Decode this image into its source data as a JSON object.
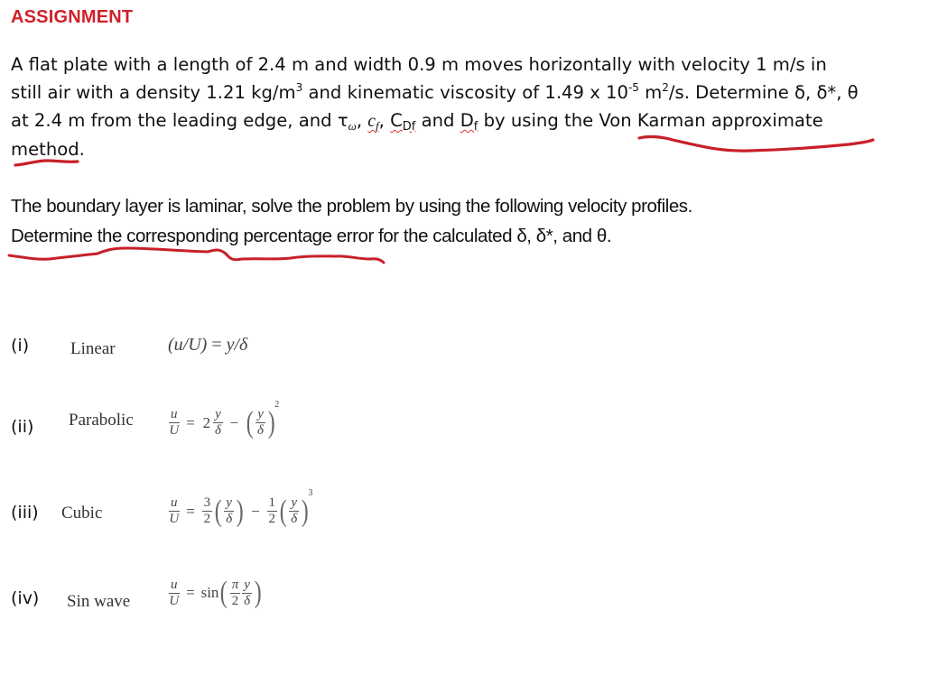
{
  "title": "ASSIGNMENT",
  "problem": {
    "line1": "A flat plate with a length of 2.4 m and width 0.9 m moves horizontally with velocity 1 m/s in",
    "line2_a": "still air with a density 1.21 kg/m",
    "line2_sup1": "3",
    "line2_b": " and kinematic viscosity of 1.49 x 10",
    "line2_sup2": "-5",
    "line2_c": " m",
    "line2_sup3": "2",
    "line2_d": "/s. Determine δ, δ*, θ",
    "line3_a": "at 2.4 m from the leading edge, and ",
    "tau": "τ",
    "tau_sub": "ω",
    "sep1": ", ",
    "cf": "c",
    "cf_sub": "f",
    "sep2": ", ",
    "cdf": "C",
    "cdf_sub": "Df",
    "line3_b": " and ",
    "df": "D",
    "df_sub": "f",
    "line3_c": " by using the Von Karman approximate",
    "line4": "method."
  },
  "instructions": {
    "line1": "The boundary layer is laminar, solve the problem by using the following velocity profiles.",
    "line2": "Determine the corresponding percentage error for the calculated δ, δ*, and θ."
  },
  "profiles": [
    {
      "label": "(i)",
      "name": "Linear",
      "equation": "(u/U) = y/δ"
    },
    {
      "label": "(ii)",
      "name": "Parabolic",
      "equation": "u/U = 2 y/δ − (y/δ)²"
    },
    {
      "label": "(iii)",
      "name": "Cubic",
      "equation": "u/U = 3/2 (y/δ) − 1/2 (y/δ)³"
    },
    {
      "label": "(iv)",
      "name": "Sin wave",
      "equation": "u/U = sin(π/2 · y/δ)"
    }
  ],
  "eq_parts": {
    "u": "u",
    "U": "U",
    "y": "y",
    "delta": "δ",
    "eq": "=",
    "minus": "−",
    "two": "2",
    "three": "3",
    "one": "1",
    "pi": "π",
    "sin": "sin",
    "lp": "(",
    "rp": ")",
    "sq": "2",
    "cube": "3",
    "slash": "/",
    "linear_lhs": "(u/U)",
    "linear_rhs": "y/δ"
  },
  "colors": {
    "title": "#d0202a",
    "annotation": "#c8202a",
    "spellcheck": "#dd3333"
  }
}
